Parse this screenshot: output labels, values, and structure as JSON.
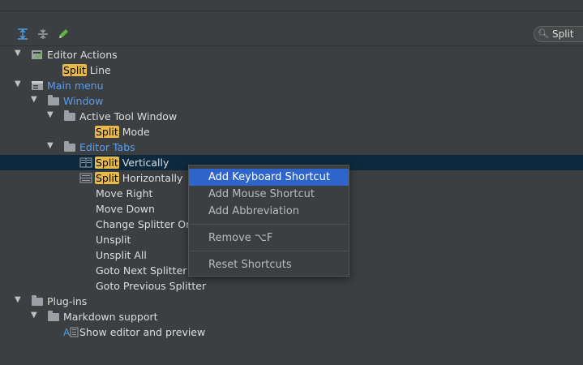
{
  "search": {
    "value": "Split"
  },
  "tree": {
    "editor_actions": "Editor Actions",
    "split_line": {
      "hl": "Split",
      "rest": " Line"
    },
    "main_menu": "Main menu",
    "window": "Window",
    "active_tool_window": "Active Tool Window",
    "split_mode": {
      "hl": "Split",
      "rest": " Mode"
    },
    "editor_tabs": "Editor Tabs",
    "split_vertically": {
      "hl": "Split",
      "rest": " Vertically"
    },
    "split_horizontally": {
      "hl": "Split",
      "rest": " Horizontally"
    },
    "move_right": "Move Right",
    "move_down": "Move Down",
    "change_splitter": "Change Splitter Or",
    "unsplit": "Unsplit",
    "unsplit_all": "Unsplit All",
    "goto_next_splitter": "Goto Next Splitter",
    "goto_prev_splitter": "Goto Previous Splitter",
    "plug_ins": "Plug-ins",
    "markdown_support": "Markdown support",
    "show_editor_preview": "Show editor and preview"
  },
  "context_menu": {
    "add_keyboard_shortcut": "Add Keyboard Shortcut",
    "add_mouse_shortcut": "Add Mouse Shortcut",
    "add_abbreviation": "Add Abbreviation",
    "remove": "Remove ⌥F",
    "reset_shortcuts": "Reset Shortcuts"
  },
  "colors": {
    "background": "#3c3f41",
    "selection_row": "#0d293e",
    "menu_highlight": "#2f65ca",
    "search_match": "#e6b949",
    "link_blue": "#589df6"
  }
}
